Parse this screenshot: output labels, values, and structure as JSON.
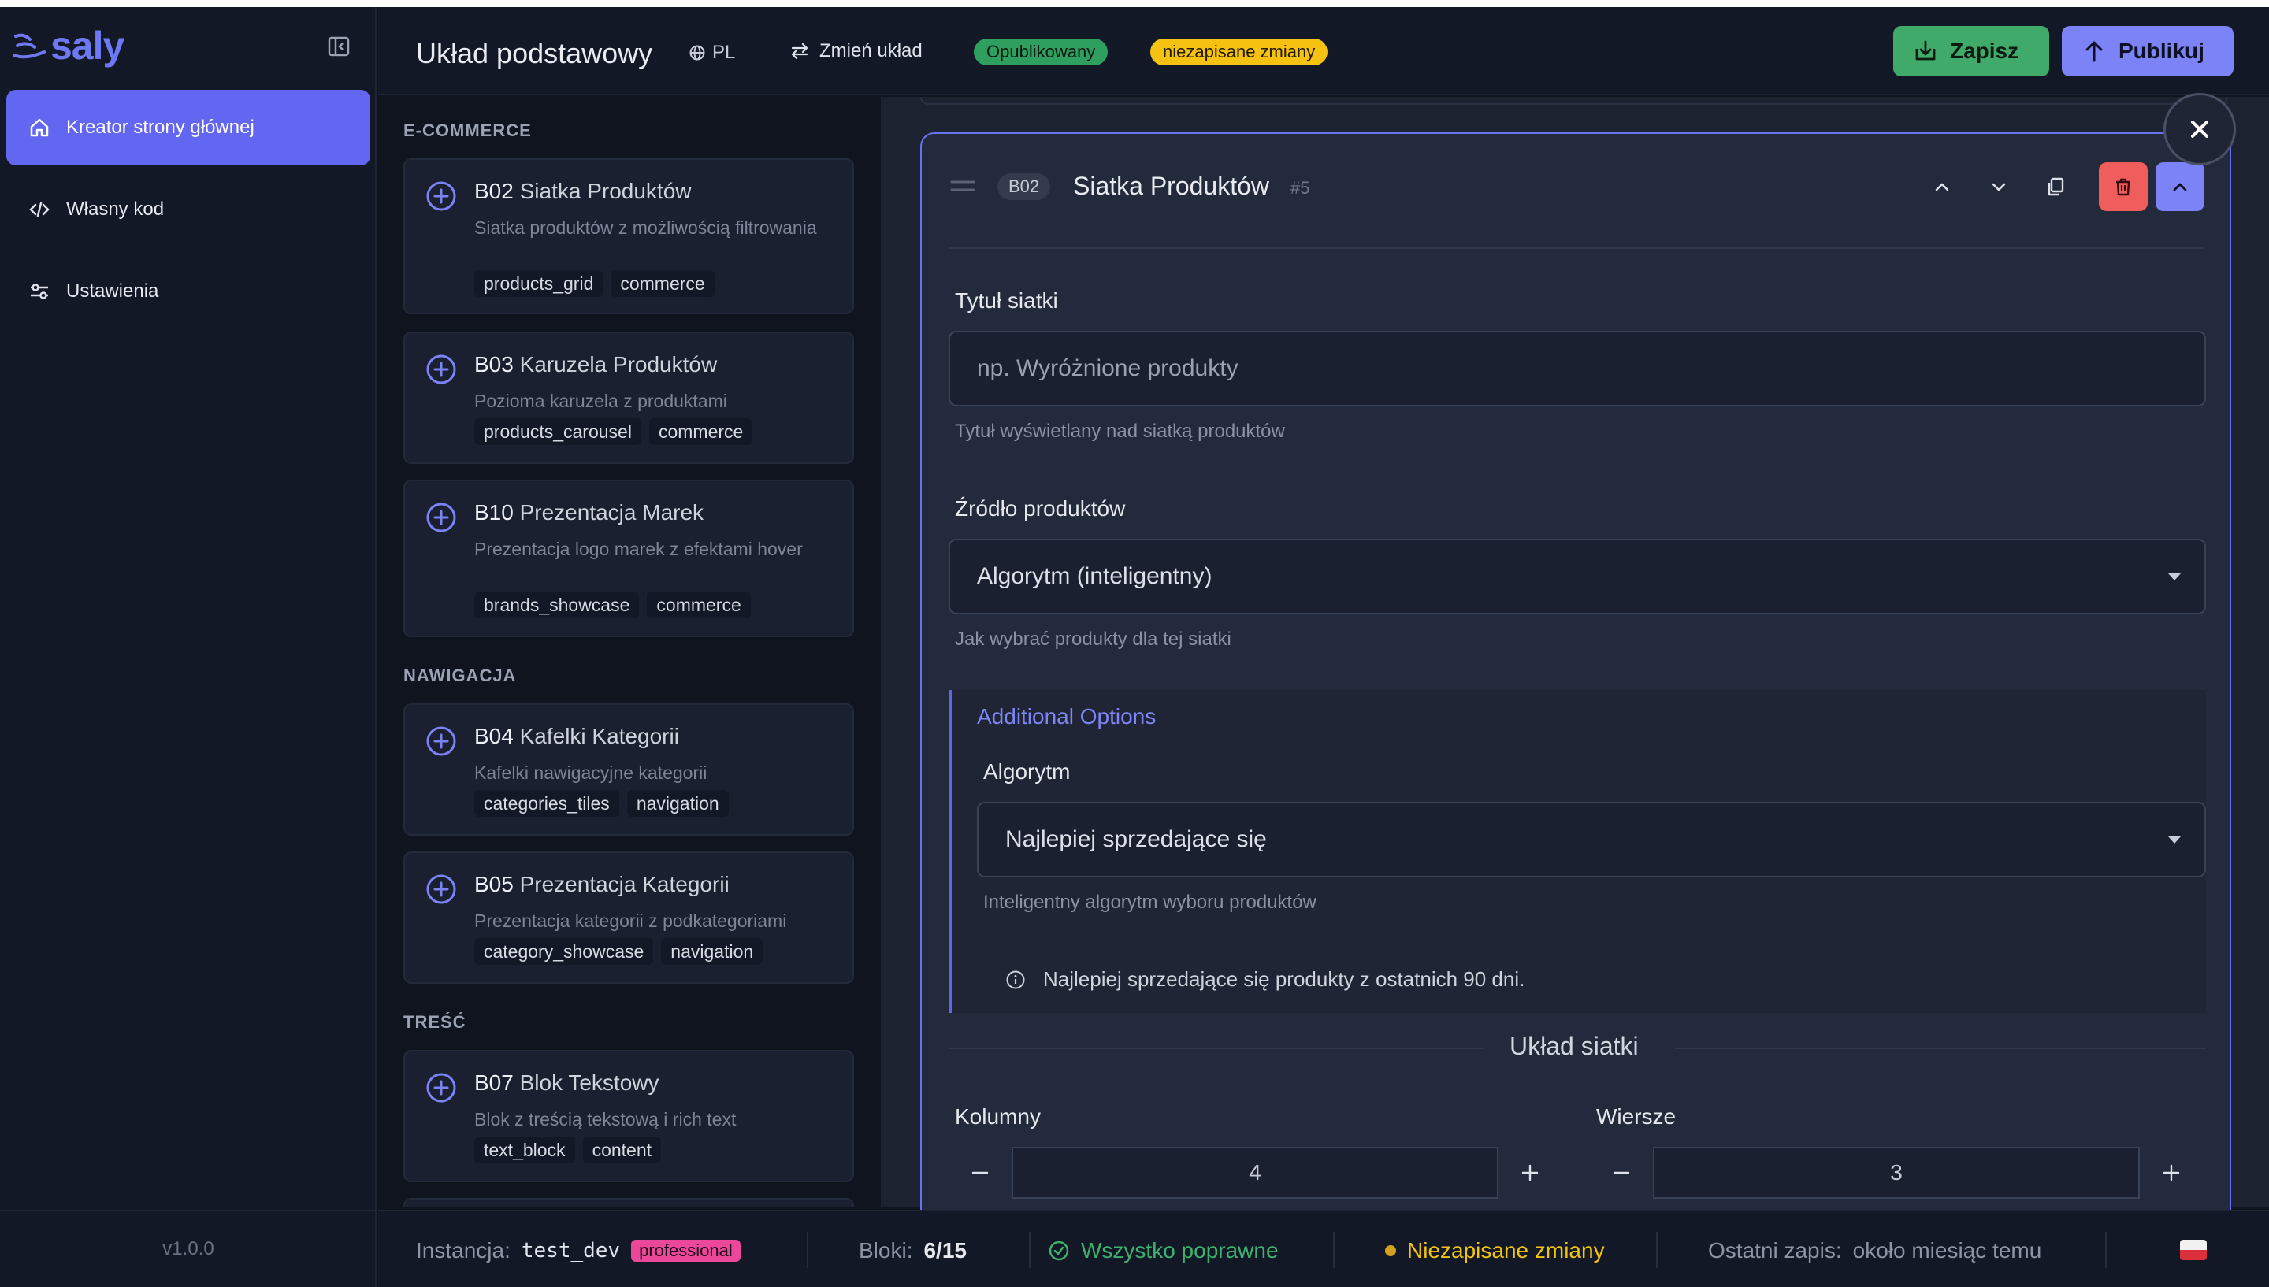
{
  "app": {
    "logo_text": "saly",
    "version": "v1.0.0"
  },
  "sidebar": {
    "items": [
      {
        "label": "Kreator strony głównej",
        "icon": "home-icon",
        "active": true
      },
      {
        "label": "Własny kod",
        "icon": "code-icon",
        "active": false
      },
      {
        "label": "Ustawienia",
        "icon": "sliders-icon",
        "active": false
      }
    ]
  },
  "header": {
    "title": "Układ podstawowy",
    "language": "PL",
    "change_layout_label": "Zmień układ",
    "status_published": "Opublikowany",
    "status_unsaved": "niezapisane zmiany",
    "save_label": "Zapisz",
    "publish_label": "Publikuj"
  },
  "catalog": {
    "groups": [
      {
        "heading": "E-COMMERCE",
        "blocks": [
          {
            "code": "B02",
            "name": "Siatka Produktów",
            "description": "Siatka produktów z możliwością filtrowania",
            "tags": [
              "products_grid",
              "commerce"
            ]
          },
          {
            "code": "B03",
            "name": "Karuzela Produktów",
            "description": "Pozioma karuzela z produktami",
            "tags": [
              "products_carousel",
              "commerce"
            ]
          },
          {
            "code": "B10",
            "name": "Prezentacja Marek",
            "description": "Prezentacja logo marek z efektami hover",
            "tags": [
              "brands_showcase",
              "commerce"
            ]
          }
        ]
      },
      {
        "heading": "NAWIGACJA",
        "blocks": [
          {
            "code": "B04",
            "name": "Kafelki Kategorii",
            "description": "Kafelki nawigacyjne kategorii",
            "tags": [
              "categories_tiles",
              "navigation"
            ]
          },
          {
            "code": "B05",
            "name": "Prezentacja Kategorii",
            "description": "Prezentacja kategorii z podkategoriami",
            "tags": [
              "category_showcase",
              "navigation"
            ]
          }
        ]
      },
      {
        "heading": "TREŚĆ",
        "blocks": [
          {
            "code": "B07",
            "name": "Blok Tekstowy",
            "description": "Blok z treścią tekstową i rich text",
            "tags": [
              "text_block",
              "content"
            ]
          }
        ]
      }
    ]
  },
  "editor": {
    "block_code": "B02",
    "block_title": "Siatka Produktów",
    "block_index": "#5",
    "grid_title": {
      "label": "Tytuł siatki",
      "placeholder": "np. Wyróżnione produkty",
      "value": "",
      "help": "Tytuł wyświetlany nad siatką produktów"
    },
    "product_source": {
      "label": "Źródło produktów",
      "value": "Algorytm (inteligentny)",
      "help": "Jak wybrać produkty dla tej siatki"
    },
    "additional_options": {
      "title": "Additional Options",
      "algorithm_label": "Algorytm",
      "algorithm_value": "Najlepiej sprzedające się",
      "algorithm_help": "Inteligentny algorytm wyboru produktów",
      "info": "Najlepiej sprzedające się produkty z ostatnich 90 dni."
    },
    "grid_layout": {
      "title": "Układ siatki",
      "columns_label": "Kolumny",
      "columns_value": "4",
      "rows_label": "Wiersze",
      "rows_value": "3"
    }
  },
  "statusbar": {
    "instance_label": "Instancja:",
    "instance_value": "test_dev",
    "plan": "professional",
    "blocks_label": "Bloki:",
    "blocks_value": "6/15",
    "validation": "Wszystko poprawne",
    "unsaved": "Niezapisane zmiany",
    "last_save_label": "Ostatni zapis:",
    "last_save_value": "około miesiąc temu"
  },
  "colors": {
    "accent": "#6366f1",
    "success": "#3faa6a",
    "warning": "#f5c211",
    "danger": "#ef5d5d",
    "background": "#0f141f"
  }
}
